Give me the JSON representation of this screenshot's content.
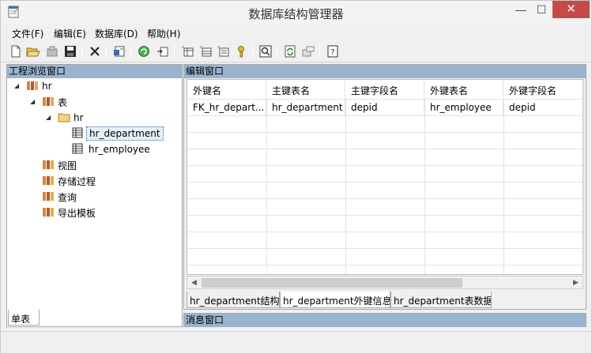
{
  "window": {
    "title": "数据库结构管理器",
    "min_label": "—",
    "max_label": "☐",
    "close_label": "✕"
  },
  "menu": [
    "文件(F)",
    "编辑(E)",
    "数据库(D)",
    "帮助(H)"
  ],
  "toolbar": {
    "icons": [
      "new-file-icon",
      "open-folder-icon",
      "close-folder-icon",
      "save-icon",
      "delete-icon",
      "properties-icon",
      "refresh-db-icon",
      "import-icon",
      "new-table-icon",
      "new-view-icon",
      "new-procedure-icon",
      "key-icon",
      "preview-icon",
      "sync-icon",
      "export-icon",
      "help-icon"
    ]
  },
  "left_pane": {
    "header": "工程浏览窗口",
    "tree": {
      "root": "hr",
      "tables_folder": "表",
      "schema": "hr",
      "table1": "hr_department",
      "table2": "hr_employee",
      "views": "视图",
      "procedures": "存储过程",
      "queries": "查询",
      "templates": "导出模板"
    },
    "tab": "单表"
  },
  "right_pane": {
    "header": "编辑窗口",
    "columns": [
      "外键名",
      "主键表名",
      "主键字段名",
      "外键表名",
      "外键字段名"
    ],
    "rows": [
      [
        "FK_hr_depart...",
        "hr_department",
        "depid",
        "hr_employee",
        "depid"
      ]
    ],
    "tabs": [
      "hr_department结构",
      "hr_department外键信息",
      "hr_department表数据"
    ],
    "active_tab_index": 1
  },
  "message_pane": {
    "header": "消息窗口"
  }
}
